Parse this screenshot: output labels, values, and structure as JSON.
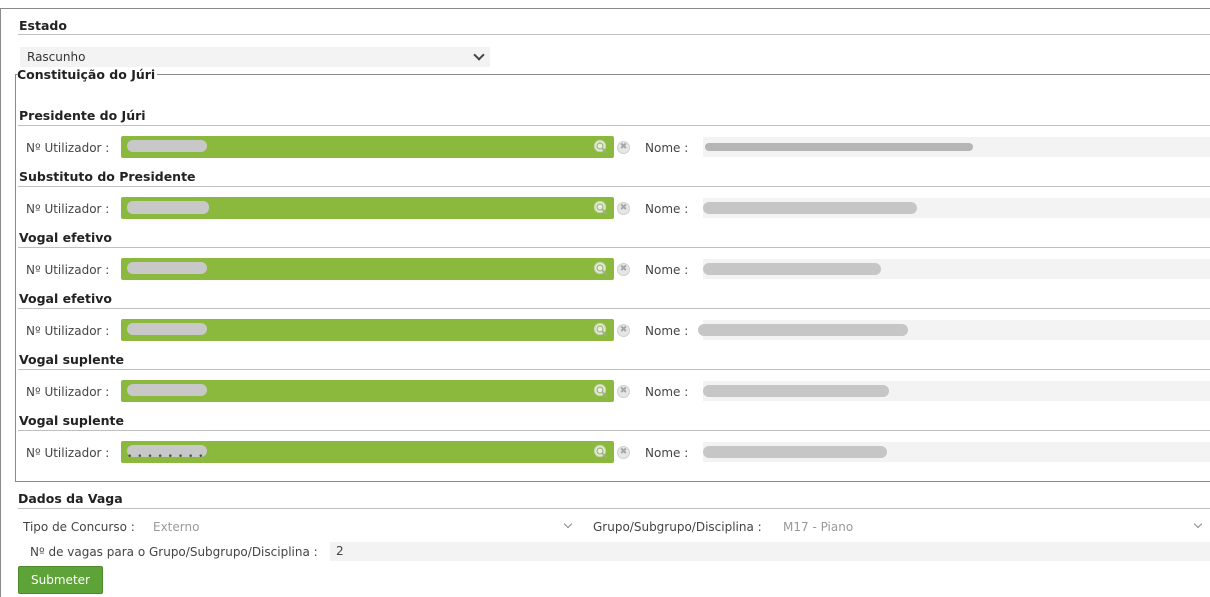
{
  "estado": {
    "title": "Estado",
    "selected": "Rascunho"
  },
  "juri": {
    "legend": "Constituição do Júri",
    "user_label": "Nº Utilizador :",
    "nome_label": "Nome :",
    "members": [
      {
        "role": "Presidente do Júri"
      },
      {
        "role": "Substituto do Presidente"
      },
      {
        "role": "Vogal efetivo"
      },
      {
        "role": "Vogal efetivo"
      },
      {
        "role": "Vogal suplente"
      },
      {
        "role": "Vogal suplente"
      }
    ]
  },
  "vaga": {
    "title": "Dados da Vaga",
    "tipo_label": "Tipo de Concurso :",
    "tipo_value": "Externo",
    "grupo_label": "Grupo/Subgrupo/Disciplina :",
    "grupo_value": "M17 - Piano",
    "vagas_label": "Nº de vagas para o Grupo/Subgrupo/Disciplina :",
    "vagas_value": "2"
  },
  "submit_label": "Submeter",
  "icons": {
    "search": "search-icon",
    "clear": "clear-icon",
    "chevron": "chevron-down-icon"
  },
  "colors": {
    "field_green": "#8ab93e",
    "submit_green": "#5ea338"
  }
}
